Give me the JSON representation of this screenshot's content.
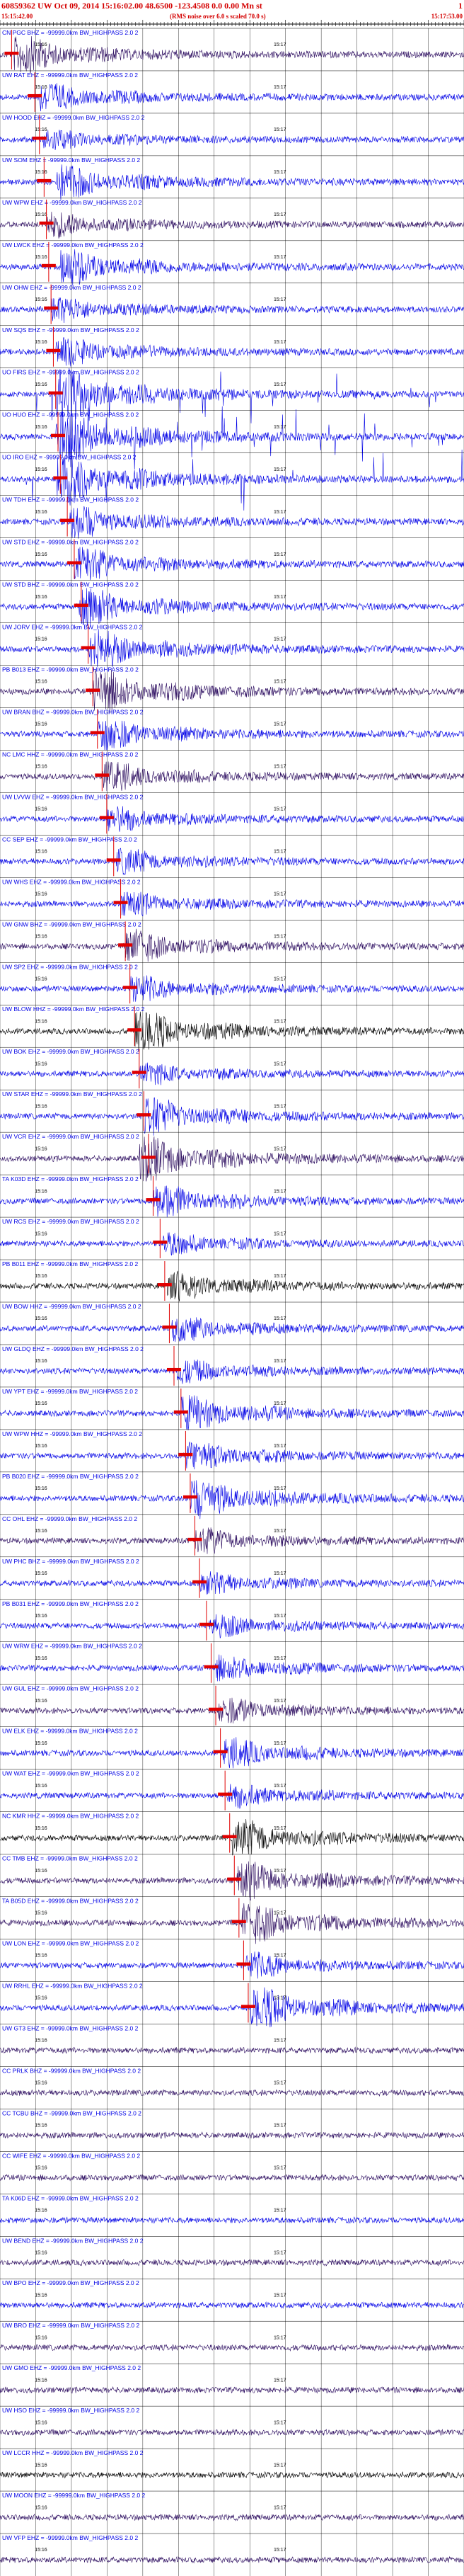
{
  "header": {
    "title": "60859362 UW Oct 09, 2014 15:16:02.00   48.6500 -123.4508  0.0 0.00 Mn st",
    "title_right": "1",
    "start_time": "15:15:42.00",
    "note": "(RMS noise over 6.0 s scaled 70.0 s)",
    "end_time": "15:17:53.00"
  },
  "colors": {
    "trace_blue": "#0000e6",
    "trace_dark": "#2a0a5e",
    "trace_black": "#000000",
    "pick_red": "#e00000",
    "grid": "#000000"
  },
  "chart_data": {
    "type": "line",
    "title": "60859362 UW Oct 09, 2014 15:16:02.00   48.6500 -123.4508  0.0 0.00 Mn st",
    "time_axis": {
      "start": "15:15:42.00",
      "end": "15:17:53.00",
      "tick_labels": [
        "15:16",
        "15:17"
      ]
    },
    "grid": true,
    "filter_label": "= -99999.0km BW_HIGHPASS  2.0  2",
    "series": [
      {
        "name": "CN PGC BHZ",
        "color": "dark",
        "amp": 0.9,
        "pick": 0.025,
        "event": 0.03
      },
      {
        "name": "UW RAT EHZ",
        "color": "blue",
        "amp": 0.7,
        "pick": 0.075,
        "event": 0.08
      },
      {
        "name": "UW HOOD EHZ",
        "color": "blue",
        "amp": 0.5,
        "pick": 0.085,
        "event": 0.09
      },
      {
        "name": "UW SOM EHZ",
        "color": "blue",
        "amp": 0.85,
        "pick": 0.095,
        "event": 0.12
      },
      {
        "name": "UW WPW EHZ",
        "color": "dark",
        "amp": 0.6,
        "pick": 0.1,
        "event": 0.1
      },
      {
        "name": "UW LWCK EHZ",
        "color": "blue",
        "amp": 0.9,
        "pick": 0.105,
        "event": 0.13
      },
      {
        "name": "UW OHW EHZ",
        "color": "blue",
        "amp": 0.6,
        "pick": 0.11,
        "event": 0.11
      },
      {
        "name": "UW SQS EHZ",
        "color": "blue",
        "amp": 0.7,
        "pick": 0.115,
        "event": 0.12
      },
      {
        "name": "UO FIRS EHZ",
        "color": "blue",
        "amp": 1.3,
        "pick": 0.12,
        "event": 0.12,
        "spiky": true
      },
      {
        "name": "UO HUO EHZ",
        "color": "blue",
        "amp": 1.3,
        "pick": 0.125,
        "event": 0.12,
        "spiky": true
      },
      {
        "name": "UO IRO EHZ",
        "color": "blue",
        "amp": 1.3,
        "pick": 0.13,
        "event": 0.12,
        "spiky": true
      },
      {
        "name": "UW TDH EHZ",
        "color": "blue",
        "amp": 0.8,
        "pick": 0.145,
        "event": 0.15
      },
      {
        "name": "UW STD EHZ",
        "color": "blue",
        "amp": 0.85,
        "pick": 0.16,
        "event": 0.16
      },
      {
        "name": "UW STD BHZ",
        "color": "blue",
        "amp": 0.9,
        "pick": 0.175,
        "event": 0.17
      },
      {
        "name": "UW JORV EHZ",
        "color": "blue",
        "amp": 0.95,
        "pick": 0.19,
        "event": 0.19
      },
      {
        "name": "PB B013 EHZ",
        "color": "dark",
        "amp": 1.1,
        "pick": 0.2,
        "event": 0.2
      },
      {
        "name": "UW BRAN BHZ",
        "color": "blue",
        "amp": 0.8,
        "pick": 0.21,
        "event": 0.21
      },
      {
        "name": "NC LMC HHZ",
        "color": "dark",
        "amp": 0.7,
        "pick": 0.22,
        "event": 0.22
      },
      {
        "name": "UW LVVW EHZ",
        "color": "blue",
        "amp": 0.6,
        "pick": 0.23,
        "event": 0.23
      },
      {
        "name": "CC SEP EHZ",
        "color": "blue",
        "amp": 0.6,
        "pick": 0.245,
        "event": 0.25
      },
      {
        "name": "UW WHS EHZ",
        "color": "blue",
        "amp": 0.55,
        "pick": 0.26,
        "event": 0.26
      },
      {
        "name": "UW GNW BHZ",
        "color": "dark",
        "amp": 0.8,
        "pick": 0.27,
        "event": 0.27
      },
      {
        "name": "UW SP2 EHZ",
        "color": "blue",
        "amp": 0.6,
        "pick": 0.28,
        "event": 0.28
      },
      {
        "name": "UW BLOW HHZ",
        "color": "black",
        "amp": 1.0,
        "pick": 0.29,
        "event": 0.29
      },
      {
        "name": "UW BOK EHZ",
        "color": "blue",
        "amp": 0.5,
        "pick": 0.3,
        "event": 0.3
      },
      {
        "name": "UW STAR EHZ",
        "color": "blue",
        "amp": 0.9,
        "pick": 0.31,
        "event": 0.31
      },
      {
        "name": "UW VCR EHZ",
        "color": "dark",
        "amp": 1.1,
        "pick": 0.32,
        "event": 0.3
      },
      {
        "name": "TA K03D EHZ",
        "color": "blue",
        "amp": 0.8,
        "pick": 0.33,
        "event": 0.33
      },
      {
        "name": "UW RCS EHZ",
        "color": "blue",
        "amp": 0.5,
        "pick": 0.345,
        "event": 0.35
      },
      {
        "name": "PB B011 EHZ",
        "color": "black",
        "amp": 0.7,
        "pick": 0.355,
        "event": 0.36
      },
      {
        "name": "UW BOW HHZ",
        "color": "blue",
        "amp": 0.6,
        "pick": 0.365,
        "event": 0.37
      },
      {
        "name": "UW GLDQ EHZ",
        "color": "blue",
        "amp": 0.55,
        "pick": 0.375,
        "event": 0.38
      },
      {
        "name": "UW YPT EHZ",
        "color": "blue",
        "amp": 0.85,
        "pick": 0.39,
        "event": 0.39
      },
      {
        "name": "UW WPW HHZ",
        "color": "blue",
        "amp": 0.7,
        "pick": 0.4,
        "event": 0.4
      },
      {
        "name": "PB B020 EHZ",
        "color": "blue",
        "amp": 1.0,
        "pick": 0.41,
        "event": 0.41
      },
      {
        "name": "CC OHL EHZ",
        "color": "dark",
        "amp": 0.6,
        "pick": 0.42,
        "event": 0.42
      },
      {
        "name": "UW PHC BHZ",
        "color": "blue",
        "amp": 0.5,
        "pick": 0.43,
        "event": 0.43
      },
      {
        "name": "PB B031 EHZ",
        "color": "blue",
        "amp": 0.5,
        "pick": 0.445,
        "event": 0.45
      },
      {
        "name": "UW WRW EHZ",
        "color": "blue",
        "amp": 0.6,
        "pick": 0.455,
        "event": 0.46
      },
      {
        "name": "UW GUL EHZ",
        "color": "dark",
        "amp": 0.6,
        "pick": 0.465,
        "event": 0.47
      },
      {
        "name": "UW ELK EHZ",
        "color": "blue",
        "amp": 0.7,
        "pick": 0.475,
        "event": 0.48
      },
      {
        "name": "UW WAT EHZ",
        "color": "blue",
        "amp": 0.55,
        "pick": 0.485,
        "event": 0.49
      },
      {
        "name": "NC KMR HHZ",
        "color": "black",
        "amp": 0.9,
        "pick": 0.495,
        "event": 0.5
      },
      {
        "name": "CC TMB EHZ",
        "color": "dark",
        "amp": 0.9,
        "pick": 0.505,
        "event": 0.51
      },
      {
        "name": "TA B05D EHZ",
        "color": "dark",
        "amp": 1.0,
        "pick": 0.515,
        "event": 0.52
      },
      {
        "name": "UW LON EHZ",
        "color": "blue",
        "amp": 0.6,
        "pick": 0.525,
        "event": 0.53
      },
      {
        "name": "UW RRHL EHZ",
        "color": "blue",
        "amp": 1.0,
        "pick": 0.535,
        "event": 0.54
      },
      {
        "name": "UW GT3 EHZ",
        "color": "dark",
        "amp": 0.3,
        "pick": -1,
        "event": -1
      },
      {
        "name": "CC PRLK BHZ",
        "color": "dark",
        "amp": 0.3,
        "pick": -1,
        "event": -1
      },
      {
        "name": "CC TCBU BHZ",
        "color": "dark",
        "amp": 0.3,
        "pick": -1,
        "event": -1
      },
      {
        "name": "CC WIFE EHZ",
        "color": "dark",
        "amp": 0.3,
        "pick": -1,
        "event": -1
      },
      {
        "name": "TA K06D EHZ",
        "color": "blue",
        "amp": 0.3,
        "pick": -1,
        "event": -1
      },
      {
        "name": "UW BEND EHZ",
        "color": "dark",
        "amp": 0.35,
        "pick": -1,
        "event": -1
      },
      {
        "name": "UW BPO EHZ",
        "color": "blue",
        "amp": 0.3,
        "pick": -1,
        "event": -1
      },
      {
        "name": "UW BRO EHZ",
        "color": "dark",
        "amp": 0.35,
        "pick": -1,
        "event": -1
      },
      {
        "name": "UW GMO EHZ",
        "color": "dark",
        "amp": 0.3,
        "pick": -1,
        "event": -1
      },
      {
        "name": "UW HSO EHZ",
        "color": "dark",
        "amp": 0.3,
        "pick": -1,
        "event": -1
      },
      {
        "name": "UW LCCR HHZ",
        "color": "black",
        "amp": 0.35,
        "pick": -1,
        "event": -1
      },
      {
        "name": "UW MOON EHZ",
        "color": "dark",
        "amp": 0.3,
        "pick": -1,
        "event": -1
      },
      {
        "name": "UW VFP EHZ",
        "color": "dark",
        "amp": 0.3,
        "pick": -1,
        "event": -1
      }
    ]
  }
}
